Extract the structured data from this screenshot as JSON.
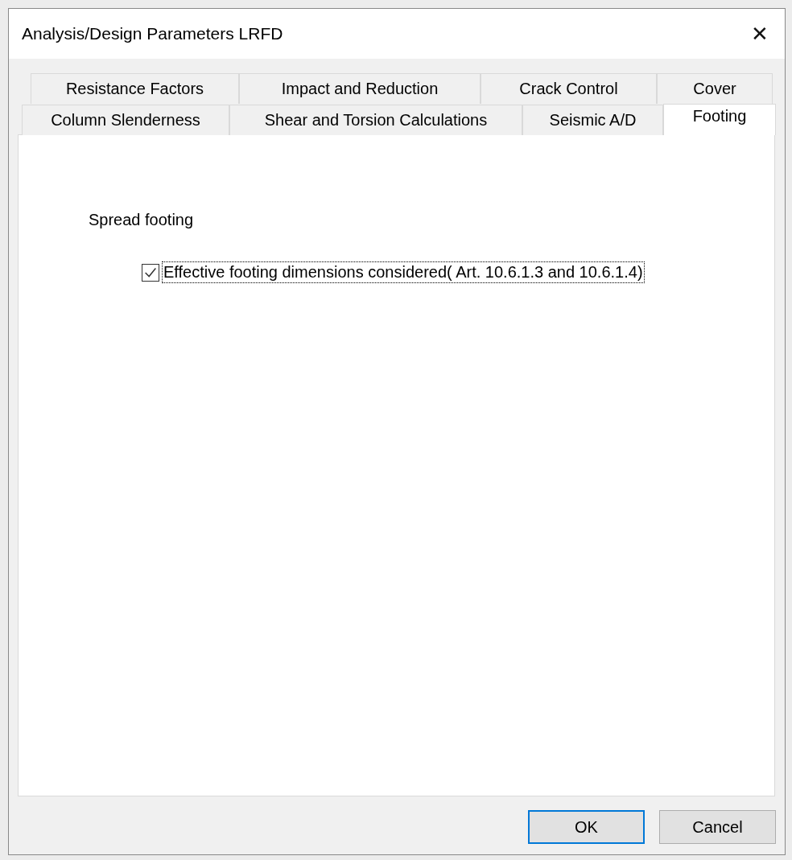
{
  "window": {
    "title": "Analysis/Design Parameters LRFD",
    "close_glyph": "✕"
  },
  "tab_rows": [
    [
      {
        "label": "Resistance Factors",
        "selected": false
      },
      {
        "label": "Impact and Reduction",
        "selected": false
      },
      {
        "label": "Crack Control",
        "selected": false
      },
      {
        "label": "Cover",
        "selected": false
      }
    ],
    [
      {
        "label": "Column Slenderness",
        "selected": false
      },
      {
        "label": "Shear and Torsion Calculations",
        "selected": false
      },
      {
        "label": "Seismic A/D",
        "selected": false
      },
      {
        "label": "Footing",
        "selected": true
      }
    ]
  ],
  "panel": {
    "group_label": "Spread footing",
    "checkbox": {
      "label": "Effective footing dimensions considered( Art. 10.6.1.3 and 10.6.1.4)",
      "checked": true,
      "focused": true
    }
  },
  "buttons": [
    {
      "label": "OK",
      "default": true
    },
    {
      "label": "Cancel",
      "default": false
    }
  ]
}
